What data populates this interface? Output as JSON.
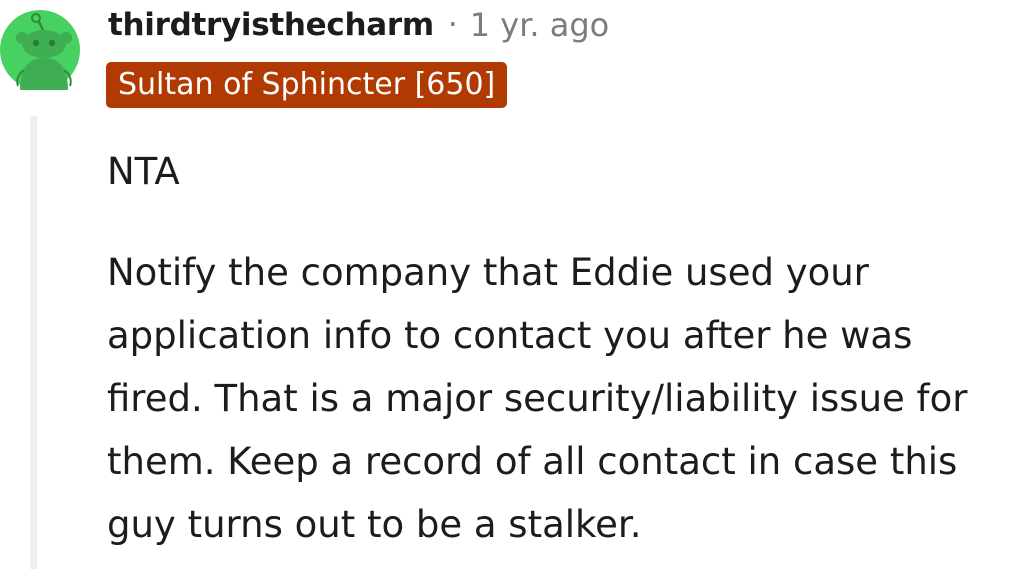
{
  "comment": {
    "username": "thirdtryisthecharm",
    "separator": "·",
    "timestamp": "1 yr. ago",
    "flair": "Sultan of Sphincter [650]",
    "avatar_icon": "snoo-avatar-icon",
    "colors": {
      "flair_bg": "#b03a02",
      "avatar_bg": "#46d160",
      "text": "#1c1c1c",
      "meta": "#7c7c7c"
    },
    "paragraphs": [
      "NTA",
      "Notify the company that Eddie used your application info to contact you after he was fired. That is a major security/liability issue for them. Keep a record of all contact in case this guy turns out to be a stalker."
    ]
  }
}
